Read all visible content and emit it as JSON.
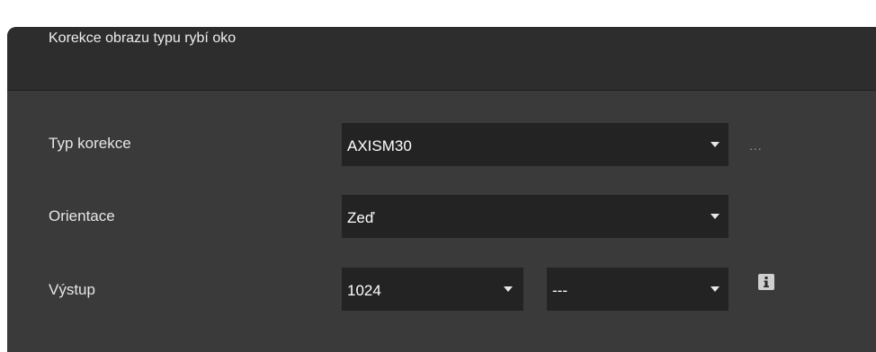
{
  "panel": {
    "title": "Korekce obrazu typu rybí oko"
  },
  "rows": {
    "correction_type": {
      "label": "Typ korekce",
      "value": "AXISM30",
      "more_button": "..."
    },
    "orientation": {
      "label": "Orientace",
      "value": "Zeď"
    },
    "output": {
      "label": "Výstup",
      "resolution_value": "1024",
      "second_value": "---"
    }
  },
  "icons": {
    "dropdown": "chevron-down-icon",
    "info": "info-icon"
  },
  "colors": {
    "panel_background": "#3a3a3a",
    "header_background": "#2d2d2d",
    "select_background": "#232323",
    "text": "#ffffff"
  }
}
